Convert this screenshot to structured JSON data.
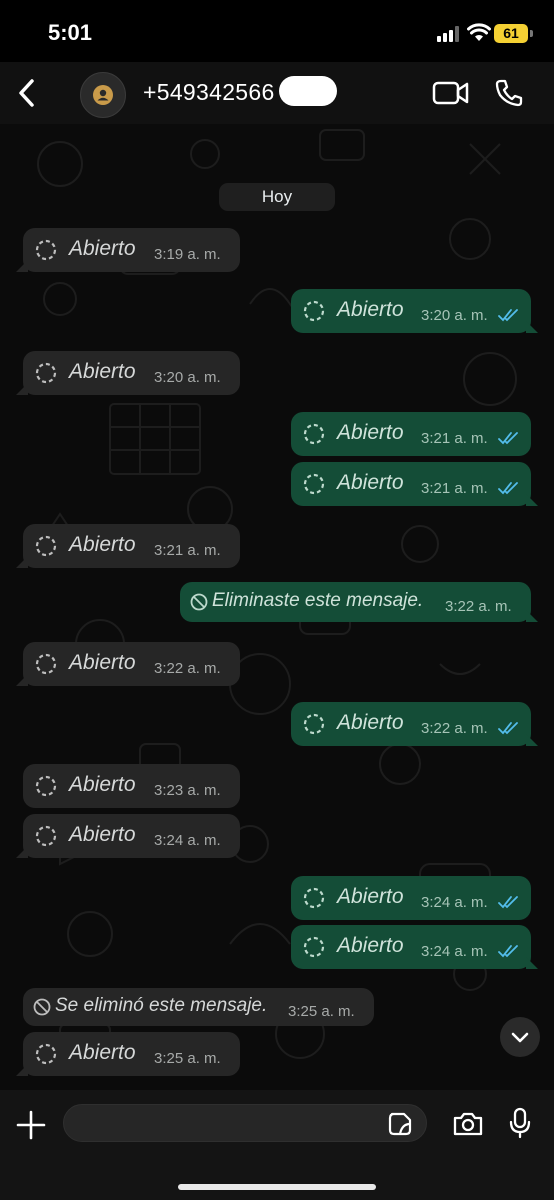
{
  "status_bar": {
    "time": "5:01",
    "battery": "61"
  },
  "header": {
    "contact": "+549342566",
    "icons": {
      "back": "chevron-left-icon",
      "video": "video-camera-icon",
      "call": "phone-icon"
    }
  },
  "chat": {
    "day_divider": "Hoy",
    "messages": [
      {
        "direction": "incoming",
        "type": "view-once",
        "text": "Abierto",
        "time": "3:19 a. m."
      },
      {
        "direction": "outgoing",
        "type": "view-once",
        "text": "Abierto",
        "time": "3:20 a. m.",
        "read": true
      },
      {
        "direction": "incoming",
        "type": "view-once",
        "text": "Abierto",
        "time": "3:20 a. m."
      },
      {
        "direction": "outgoing",
        "type": "view-once",
        "text": "Abierto",
        "time": "3:21 a. m.",
        "read": true
      },
      {
        "direction": "outgoing",
        "type": "view-once",
        "text": "Abierto",
        "time": "3:21 a. m.",
        "read": true
      },
      {
        "direction": "incoming",
        "type": "view-once",
        "text": "Abierto",
        "time": "3:21 a. m."
      },
      {
        "direction": "outgoing",
        "type": "deleted",
        "text": "Eliminaste este mensaje.",
        "time": "3:22 a. m."
      },
      {
        "direction": "incoming",
        "type": "view-once",
        "text": "Abierto",
        "time": "3:22 a. m."
      },
      {
        "direction": "outgoing",
        "type": "view-once",
        "text": "Abierto",
        "time": "3:22 a. m.",
        "read": true
      },
      {
        "direction": "incoming",
        "type": "view-once",
        "text": "Abierto",
        "time": "3:23 a. m."
      },
      {
        "direction": "incoming",
        "type": "view-once",
        "text": "Abierto",
        "time": "3:24 a. m."
      },
      {
        "direction": "outgoing",
        "type": "view-once",
        "text": "Abierto",
        "time": "3:24 a. m.",
        "read": true
      },
      {
        "direction": "outgoing",
        "type": "view-once",
        "text": "Abierto",
        "time": "3:24 a. m.",
        "read": true
      },
      {
        "direction": "incoming",
        "type": "deleted",
        "text": "Se eliminó este mensaje.",
        "time": "3:25 a. m."
      },
      {
        "direction": "incoming",
        "type": "view-once",
        "text": "Abierto",
        "time": "3:25 a. m."
      }
    ]
  },
  "composer": {
    "message_value": "",
    "icons": {
      "plus": "plus-icon",
      "sticker": "sticker-icon",
      "camera": "camera-icon",
      "mic": "microphone-icon"
    }
  },
  "colors": {
    "incoming_bubble": "#262626",
    "outgoing_bubble": "#144d37",
    "read_ticks": "#53bdeb",
    "battery": "#f4d033"
  }
}
